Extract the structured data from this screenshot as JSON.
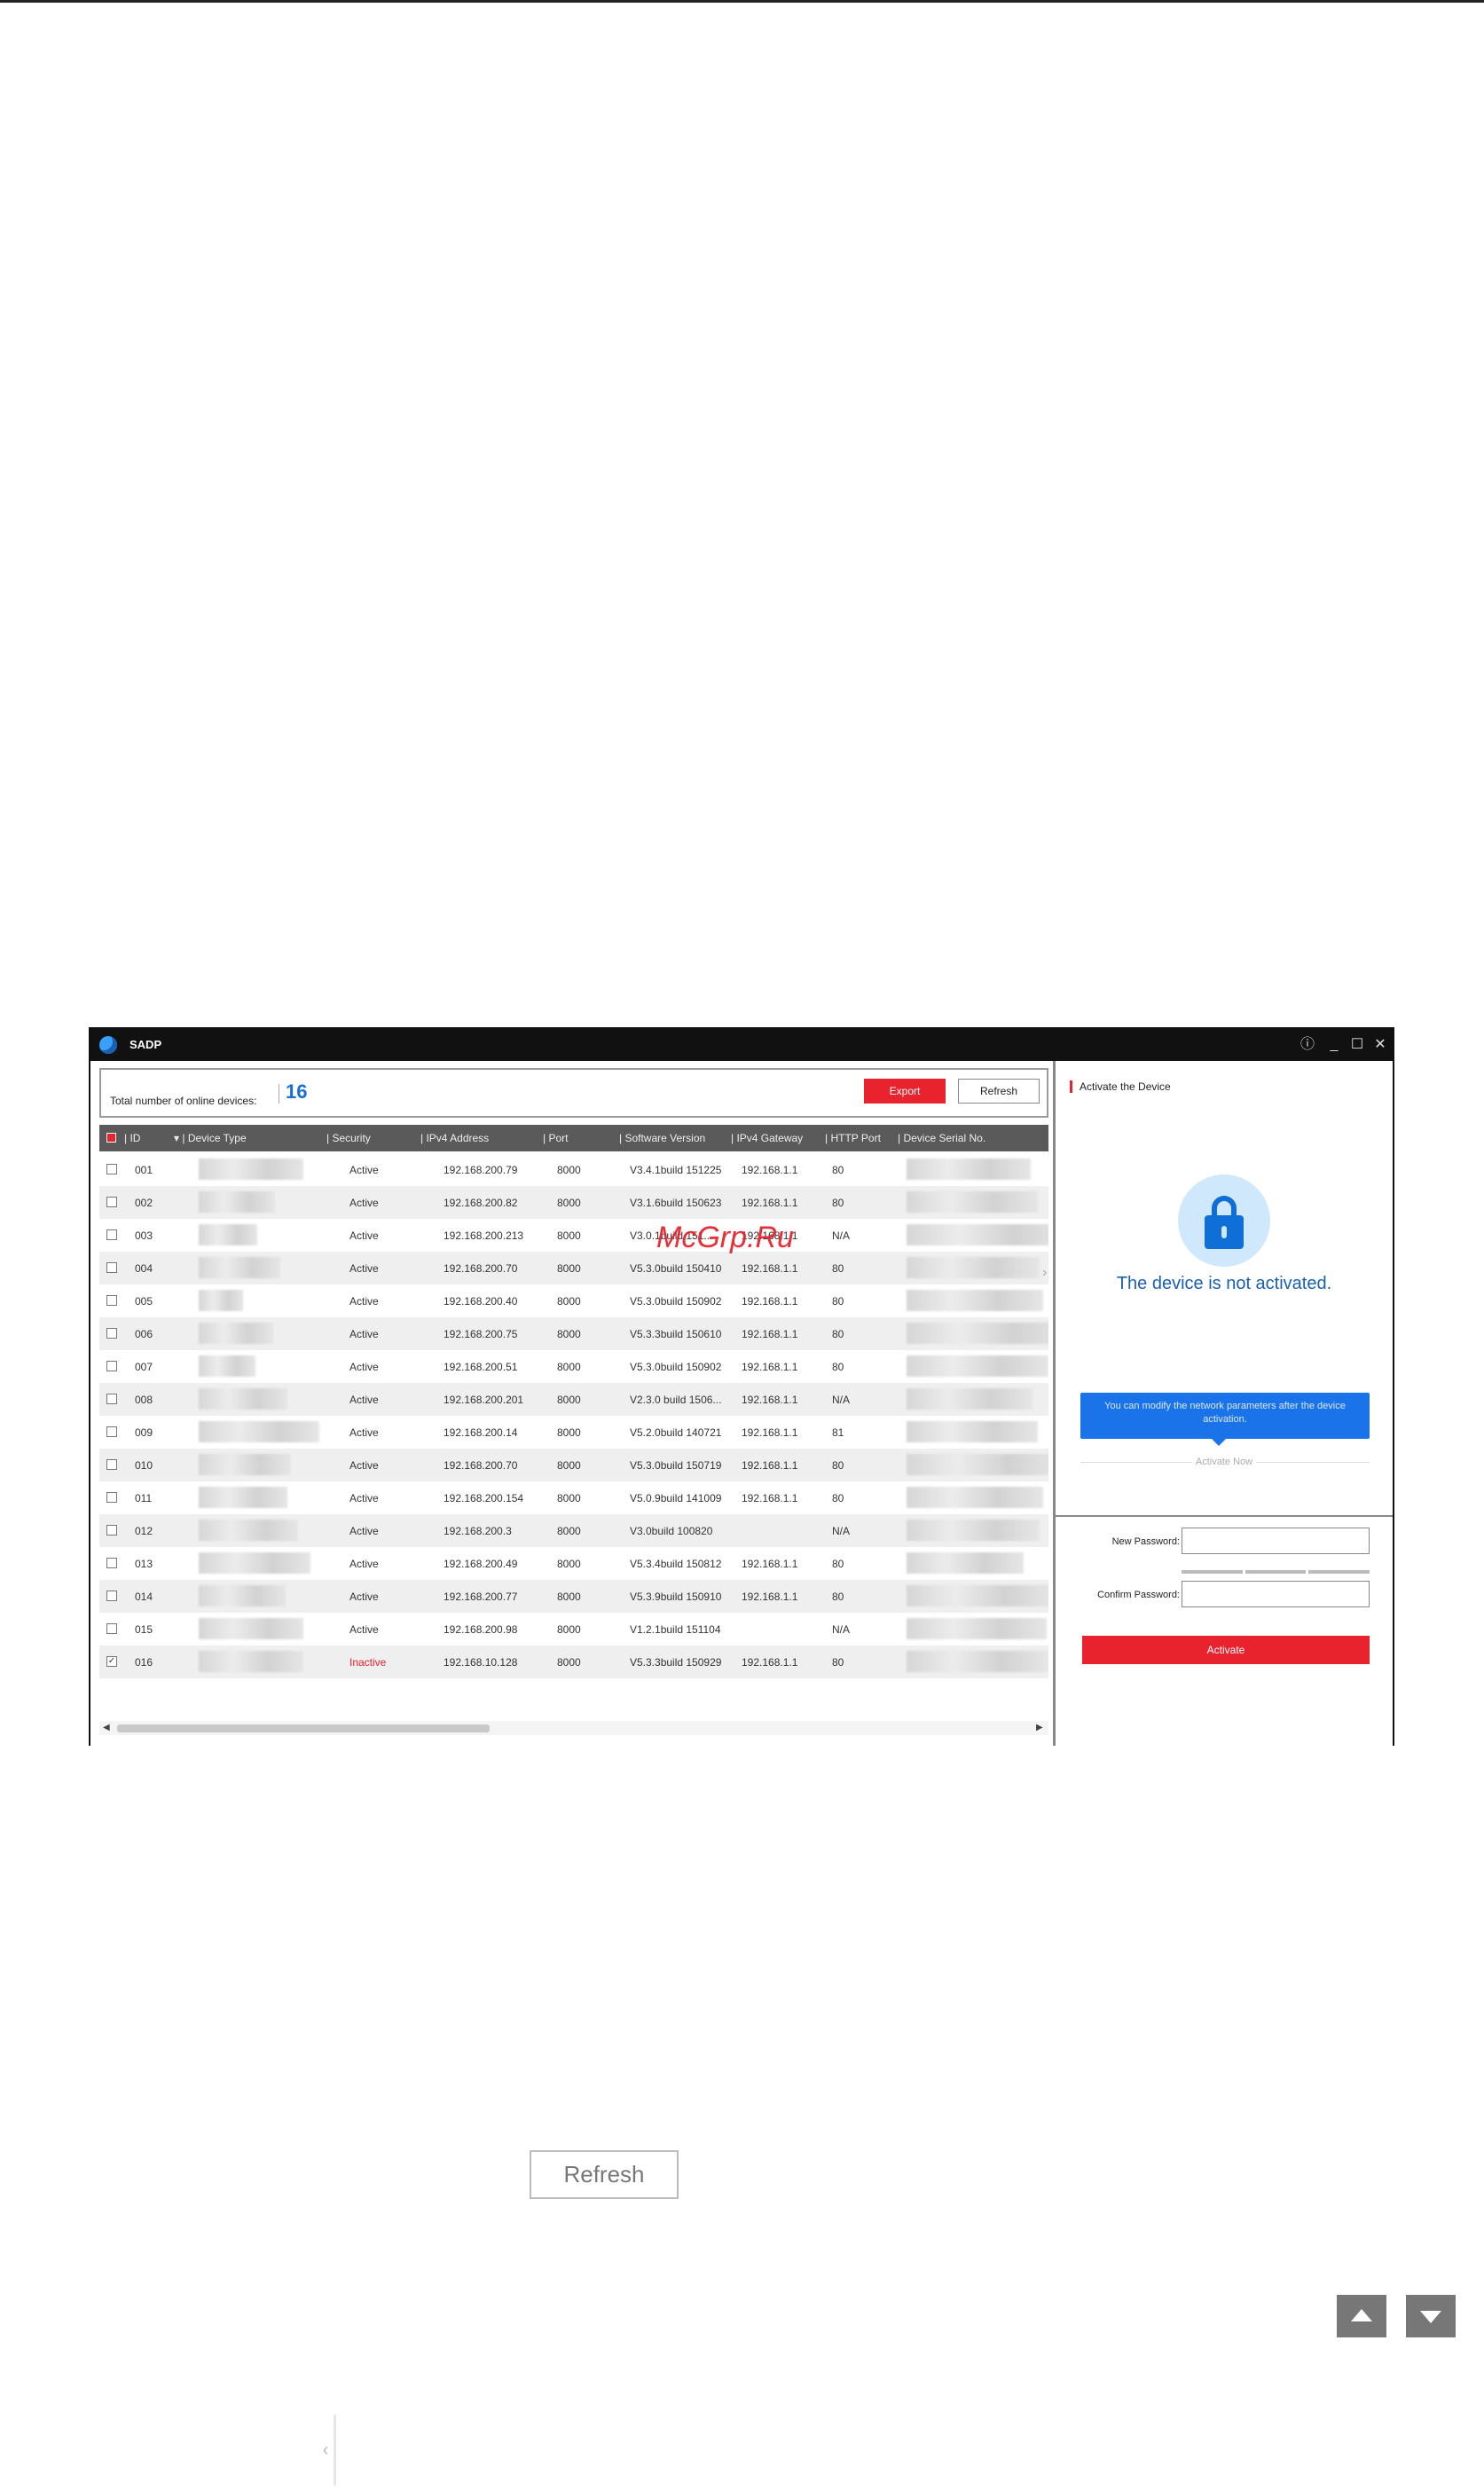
{
  "window": {
    "title": "SADP",
    "controls": [
      "info-icon",
      "minimize-icon",
      "maximize-icon",
      "close-icon"
    ]
  },
  "summary": {
    "label": "Total number of online devices:",
    "count": "16",
    "export_label": "Export",
    "refresh_label": "Refresh"
  },
  "table": {
    "columns": [
      "ID",
      "Device Type",
      "Security",
      "IPv4 Address",
      "Port",
      "Software Version",
      "IPv4 Gateway",
      "HTTP Port",
      "Device Serial No."
    ],
    "rows": [
      {
        "id": "001",
        "security": "Active",
        "ip": "192.168.200.79",
        "port": "8000",
        "version": "V3.4.1build 151225",
        "gateway": "192.168.1.1",
        "http": "80",
        "checked": false
      },
      {
        "id": "002",
        "security": "Active",
        "ip": "192.168.200.82",
        "port": "8000",
        "version": "V3.1.6build 150623",
        "gateway": "192.168.1.1",
        "http": "80",
        "checked": false
      },
      {
        "id": "003",
        "security": "Active",
        "ip": "192.168.200.213",
        "port": "8000",
        "version": "V3.0.1build 151...",
        "gateway": "192.168.1.1",
        "http": "N/A",
        "checked": false
      },
      {
        "id": "004",
        "security": "Active",
        "ip": "192.168.200.70",
        "port": "8000",
        "version": "V5.3.0build 150410",
        "gateway": "192.168.1.1",
        "http": "80",
        "checked": false
      },
      {
        "id": "005",
        "security": "Active",
        "ip": "192.168.200.40",
        "port": "8000",
        "version": "V5.3.0build 150902",
        "gateway": "192.168.1.1",
        "http": "80",
        "checked": false
      },
      {
        "id": "006",
        "security": "Active",
        "ip": "192.168.200.75",
        "port": "8000",
        "version": "V5.3.3build 150610",
        "gateway": "192.168.1.1",
        "http": "80",
        "checked": false
      },
      {
        "id": "007",
        "security": "Active",
        "ip": "192.168.200.51",
        "port": "8000",
        "version": "V5.3.0build 150902",
        "gateway": "192.168.1.1",
        "http": "80",
        "checked": false
      },
      {
        "id": "008",
        "security": "Active",
        "ip": "192.168.200.201",
        "port": "8000",
        "version": "V2.3.0 build 1506...",
        "gateway": "192.168.1.1",
        "http": "N/A",
        "checked": false
      },
      {
        "id": "009",
        "security": "Active",
        "ip": "192.168.200.14",
        "port": "8000",
        "version": "V5.2.0build 140721",
        "gateway": "192.168.1.1",
        "http": "81",
        "checked": false
      },
      {
        "id": "010",
        "security": "Active",
        "ip": "192.168.200.70",
        "port": "8000",
        "version": "V5.3.0build 150719",
        "gateway": "192.168.1.1",
        "http": "80",
        "checked": false
      },
      {
        "id": "011",
        "security": "Active",
        "ip": "192.168.200.154",
        "port": "8000",
        "version": "V5.0.9build 141009",
        "gateway": "192.168.1.1",
        "http": "80",
        "checked": false
      },
      {
        "id": "012",
        "security": "Active",
        "ip": "192.168.200.3",
        "port": "8000",
        "version": "V3.0build 100820",
        "gateway": "",
        "http": "N/A",
        "checked": false
      },
      {
        "id": "013",
        "security": "Active",
        "ip": "192.168.200.49",
        "port": "8000",
        "version": "V5.3.4build 150812",
        "gateway": "192.168.1.1",
        "http": "80",
        "checked": false
      },
      {
        "id": "014",
        "security": "Active",
        "ip": "192.168.200.77",
        "port": "8000",
        "version": "V5.3.9build 150910",
        "gateway": "192.168.1.1",
        "http": "80",
        "checked": false
      },
      {
        "id": "015",
        "security": "Active",
        "ip": "192.168.200.98",
        "port": "8000",
        "version": "V1.2.1build 151104",
        "gateway": "",
        "http": "N/A",
        "checked": false
      },
      {
        "id": "016",
        "security": "Inactive",
        "ip": "192.168.10.128",
        "port": "8000",
        "version": "V5.3.3build 150929",
        "gateway": "192.168.1.1",
        "http": "80",
        "checked": true
      }
    ]
  },
  "activate_panel": {
    "title": "Activate the Device",
    "status": "The device is not activated.",
    "tooltip": "You can modify the network parameters after the device activation.",
    "activate_now": "Activate Now",
    "new_password_label": "New Password:",
    "confirm_password_label": "Confirm Password:",
    "activate_button": "Activate"
  },
  "watermark": "McGrp.Ru",
  "page": {
    "refresh_button": "Refresh"
  },
  "colors": {
    "accent_red": "#e8232e",
    "accent_blue": "#1a73e8",
    "titlebar": "#111111"
  }
}
